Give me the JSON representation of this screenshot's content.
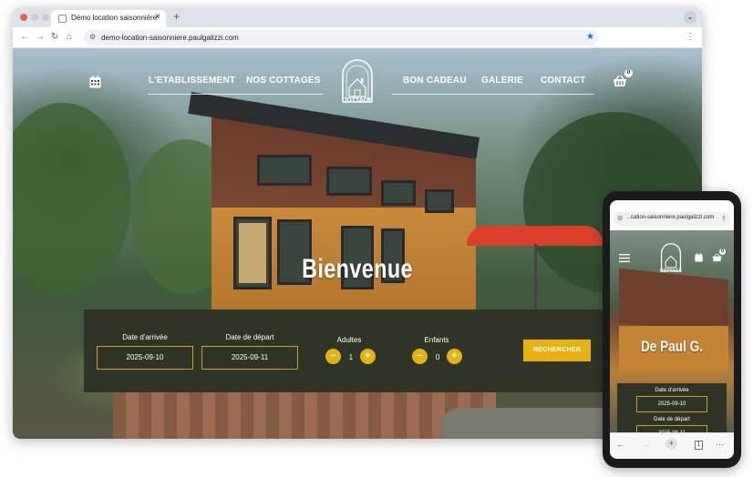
{
  "browser": {
    "tab_title": "Démo location saisonnière",
    "new_tab": "+",
    "tab_close": "×",
    "url": "demo-location-saisonniere.paulgalizzi.com",
    "traffic_colors": [
      "#ee5f5a",
      "#bdbdbd",
      "#bdbdbd"
    ]
  },
  "site": {
    "nav": {
      "links": [
        "L'ETABLISSEMENT",
        "NOS COTTAGES",
        "BON CADEAU",
        "GALERIE",
        "CONTACT"
      ],
      "logo_text": "COTTAGE",
      "cart_count": "0"
    },
    "hero_title": "Bienvenue",
    "booking": {
      "arrival_label": "Date d'arrivée",
      "arrival_value": "2025-09-10",
      "departure_label": "Date de départ",
      "departure_value": "2025-09-11",
      "adults_label": "Adultes",
      "adults_value": "1",
      "children_label": "Enfants",
      "children_value": "0",
      "minus": "−",
      "plus": "+",
      "search_label": "RECHERCHER"
    },
    "colors": {
      "accent": "#e8b20e",
      "panel": "#2f3426",
      "border": "#c9a227"
    }
  },
  "mobile": {
    "url": "...cation-saisonniere.paulgalizzi.com",
    "logo_text": "COTTAGE",
    "cart_count": "0",
    "hero_title": "De Paul G.",
    "arrival_label": "Date d'arrivée",
    "arrival_value": "2025-09-10",
    "departure_label": "Date de départ",
    "departure_value": "2025-09-11"
  }
}
